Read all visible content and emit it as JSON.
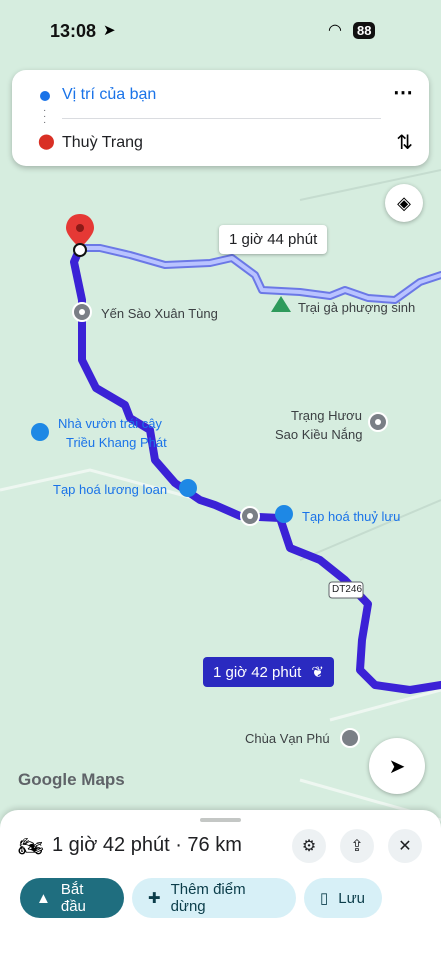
{
  "status_bar": {
    "time": "13:08",
    "battery": "88"
  },
  "directions": {
    "origin": "Vị trí của bạn",
    "destination": "Thuỳ Trang"
  },
  "map": {
    "alt_route_time": "1 giờ 44 phút",
    "main_route_time": "1 giờ 42 phút",
    "places": [
      "Yến Sào Xuân Tùng",
      "Trại gà phượng sinh",
      "Nhà vườn trái cây",
      "Triều Khang Phát",
      "Trạng Hươu",
      "Sao Kiều Nắng",
      "Tạp hoá lương loan",
      "Tạp hoá thuỷ lưu",
      "Chùa Vạn Phú"
    ],
    "road_label": "DT246",
    "google_logo": "Google Maps"
  },
  "bottom_sheet": {
    "summary": "1 giờ 42 phút · 76 km",
    "start_label": "Bắt đầu",
    "add_stop_label": "Thêm điểm dừng",
    "save_label": "Lưu"
  },
  "colors": {
    "route_main": "#3b22d6",
    "route_alt": "#a9b4ff",
    "accent": "#1f6e7f"
  }
}
